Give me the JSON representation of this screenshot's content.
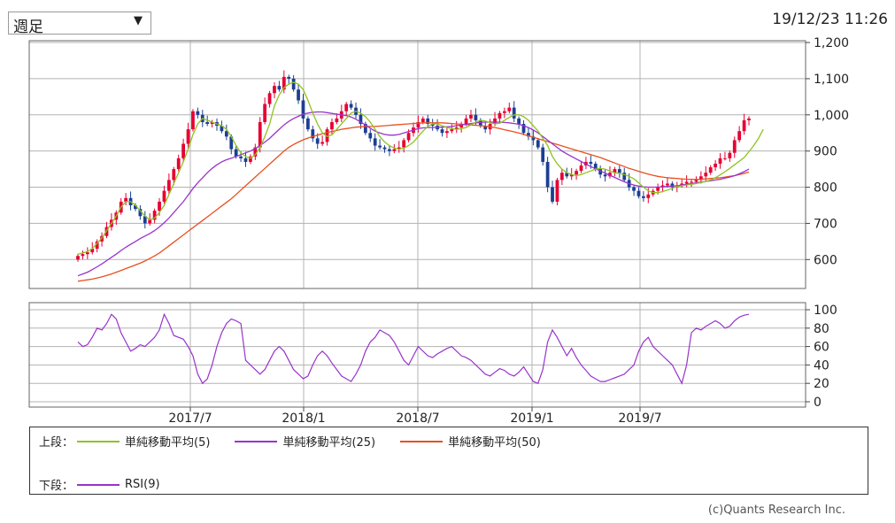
{
  "controls": {
    "period_value": "週足",
    "dropdown_arrow": "▼",
    "timestamp": "19/12/23 11:26"
  },
  "legend": {
    "upper_label": "上段：",
    "lower_label": "下段：",
    "items_upper": [
      {
        "label": "単純移動平均(5)",
        "color": "#8fc31f"
      },
      {
        "label": "単純移動平均(25)",
        "color": "#9933cc"
      },
      {
        "label": "単純移動平均(50)",
        "color": "#e8501e"
      }
    ],
    "items_lower": [
      {
        "label": "RSI(9)",
        "color": "#9933cc"
      }
    ]
  },
  "copyright": "(c)Quants Research Inc.",
  "colors": {
    "up_candle": "#e60033",
    "down_candle": "#1c3f94",
    "grid": "#b3b3b3"
  },
  "chart_data": [
    {
      "type": "candlestick",
      "panel": "upper",
      "x_tick_labels": [
        "2017/7",
        "2018/1",
        "2018/7",
        "2019/1",
        "2019/7"
      ],
      "y_ticks": [
        "1,200",
        "1,100",
        "1,000",
        "900",
        "800",
        "700",
        "600"
      ],
      "ylim": [
        520,
        1205
      ],
      "close": [
        610,
        615,
        620,
        630,
        650,
        665,
        690,
        710,
        730,
        760,
        770,
        750,
        740,
        720,
        700,
        710,
        735,
        760,
        790,
        820,
        850,
        880,
        920,
        960,
        1010,
        1000,
        980,
        975,
        980,
        970,
        955,
        940,
        905,
        885,
        880,
        870,
        885,
        910,
        980,
        1030,
        1060,
        1080,
        1070,
        1105,
        1100,
        1070,
        1040,
        990,
        960,
        935,
        920,
        925,
        960,
        980,
        990,
        1010,
        1030,
        1020,
        1000,
        975,
        950,
        935,
        915,
        910,
        905,
        900,
        905,
        910,
        930,
        950,
        965,
        980,
        990,
        975,
        970,
        960,
        950,
        955,
        960,
        965,
        975,
        990,
        1000,
        985,
        970,
        960,
        975,
        990,
        1005,
        1010,
        1020,
        990,
        975,
        950,
        940,
        930,
        910,
        870,
        800,
        760,
        820,
        840,
        830,
        835,
        845,
        860,
        870,
        865,
        850,
        835,
        830,
        840,
        850,
        840,
        820,
        800,
        790,
        775,
        770,
        780,
        790,
        800,
        805,
        810,
        800,
        805,
        810,
        815,
        815,
        820,
        830,
        840,
        855,
        865,
        880,
        880,
        895,
        930,
        955,
        985,
        990
      ],
      "ma5": [
        615,
        618,
        622,
        630,
        645,
        660,
        680,
        700,
        720,
        745,
        760,
        760,
        750,
        735,
        720,
        710,
        715,
        730,
        750,
        780,
        810,
        840,
        870,
        905,
        945,
        975,
        990,
        985,
        980,
        975,
        970,
        960,
        940,
        915,
        895,
        885,
        880,
        890,
        910,
        940,
        975,
        1025,
        1055,
        1075,
        1085,
        1090,
        1085,
        1070,
        1040,
        1005,
        975,
        950,
        940,
        945,
        960,
        975,
        990,
        1005,
        1010,
        1005,
        995,
        980,
        960,
        940,
        925,
        915,
        908,
        905,
        908,
        915,
        925,
        940,
        955,
        968,
        975,
        975,
        970,
        965,
        962,
        960,
        962,
        965,
        972,
        980,
        985,
        983,
        978,
        975,
        977,
        985,
        993,
        1000,
        1000,
        995,
        985,
        970,
        955,
        935,
        915,
        885,
        865,
        850,
        840,
        835,
        832,
        835,
        840,
        845,
        850,
        852,
        850,
        845,
        840,
        838,
        835,
        830,
        823,
        812,
        800,
        790,
        785,
        785,
        788,
        792,
        797,
        802,
        804,
        806,
        808,
        810,
        813,
        816,
        820,
        826,
        834,
        843,
        852,
        862,
        872,
        882,
        898,
        915,
        935,
        960
      ],
      "ma25": [
        555,
        560,
        565,
        572,
        580,
        588,
        597,
        606,
        615,
        625,
        634,
        642,
        650,
        658,
        665,
        672,
        680,
        690,
        702,
        715,
        730,
        745,
        760,
        778,
        796,
        812,
        826,
        840,
        852,
        862,
        870,
        876,
        880,
        885,
        890,
        895,
        900,
        907,
        915,
        925,
        935,
        948,
        960,
        972,
        982,
        990,
        996,
        1002,
        1005,
        1007,
        1008,
        1008,
        1006,
        1004,
        1002,
        1000,
        998,
        994,
        988,
        980,
        972,
        963,
        955,
        950,
        946,
        944,
        944,
        946,
        950,
        954,
        958,
        962,
        964,
        965,
        965,
        966,
        966,
        967,
        968,
        970,
        972,
        974,
        976,
        978,
        979,
        980,
        980,
        980,
        980,
        979,
        978,
        976,
        974,
        970,
        965,
        958,
        950,
        940,
        930,
        920,
        910,
        900,
        892,
        885,
        878,
        871,
        864,
        857,
        851,
        845,
        839,
        833,
        827,
        821,
        815,
        810,
        806,
        803,
        801,
        800,
        800,
        800,
        801,
        802,
        803,
        804,
        806,
        808,
        810,
        812,
        814,
        816,
        818,
        820,
        822,
        825,
        828,
        832,
        837,
        843,
        850
      ],
      "ma50": [
        540,
        542,
        544,
        546,
        549,
        552,
        556,
        560,
        565,
        570,
        575,
        580,
        585,
        590,
        596,
        603,
        610,
        618,
        628,
        638,
        648,
        658,
        668,
        678,
        688,
        698,
        708,
        718,
        728,
        738,
        748,
        758,
        768,
        780,
        792,
        804,
        816,
        828,
        840,
        852,
        864,
        876,
        888,
        900,
        910,
        918,
        925,
        931,
        936,
        940,
        944,
        948,
        951,
        954,
        957,
        960,
        962,
        964,
        966,
        967,
        968,
        968,
        968,
        969,
        970,
        971,
        972,
        973,
        974,
        975,
        976,
        977,
        978,
        978,
        978,
        978,
        978,
        977,
        976,
        975,
        974,
        973,
        972,
        971,
        970,
        969,
        967,
        965,
        962,
        959,
        956,
        953,
        950,
        946,
        942,
        938,
        934,
        930,
        926,
        922,
        918,
        914,
        910,
        906,
        902,
        898,
        894,
        890,
        886,
        882,
        877,
        872,
        867,
        862,
        857,
        852,
        848,
        844,
        840,
        836,
        833,
        830,
        828,
        826,
        825,
        824,
        823,
        822,
        822,
        822,
        822,
        823,
        824,
        825,
        826,
        828,
        830,
        832,
        835,
        838,
        842
      ]
    },
    {
      "type": "line",
      "panel": "lower",
      "series": [
        {
          "name": "RSI(9)",
          "values": [
            65,
            60,
            62,
            70,
            80,
            78,
            85,
            95,
            90,
            75,
            65,
            55,
            58,
            62,
            60,
            65,
            70,
            78,
            95,
            85,
            72,
            70,
            68,
            60,
            50,
            30,
            20,
            25,
            40,
            60,
            75,
            85,
            90,
            88,
            85,
            45,
            40,
            35,
            30,
            35,
            45,
            55,
            60,
            55,
            45,
            35,
            30,
            25,
            28,
            40,
            50,
            55,
            50,
            42,
            35,
            28,
            25,
            22,
            30,
            40,
            55,
            65,
            70,
            78,
            75,
            72,
            65,
            55,
            45,
            40,
            50,
            60,
            55,
            50,
            48,
            52,
            55,
            58,
            60,
            55,
            50,
            48,
            45,
            40,
            35,
            30,
            28,
            32,
            36,
            34,
            30,
            28,
            32,
            38,
            30,
            22,
            20,
            35,
            65,
            78,
            70,
            60,
            50,
            58,
            48,
            40,
            34,
            28,
            25,
            22,
            22,
            24,
            26,
            28,
            30,
            35,
            40,
            55,
            65,
            70,
            60,
            55,
            50,
            45,
            40,
            30,
            20,
            40,
            75,
            80,
            78,
            82,
            85,
            88,
            85,
            80,
            82,
            88,
            92,
            94,
            95
          ]
        }
      ],
      "y_ticks": [
        "100",
        "80",
        "60",
        "40",
        "20",
        "0"
      ],
      "ylim": [
        0,
        100
      ]
    }
  ]
}
